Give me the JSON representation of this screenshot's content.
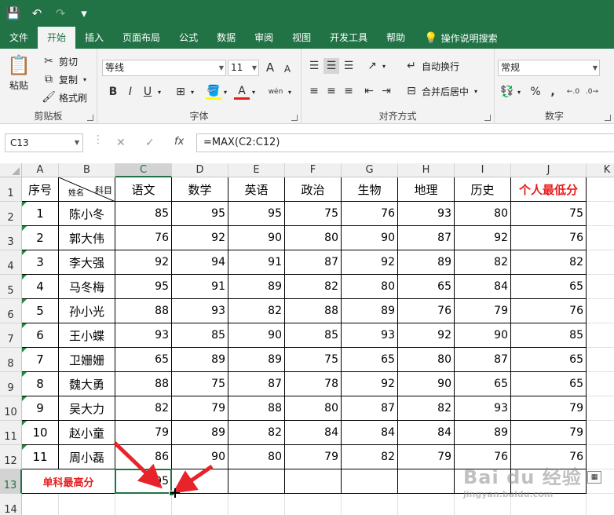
{
  "qat": {
    "save": "💾",
    "undo": "↶",
    "redo": "↷",
    "customize": "▾"
  },
  "tabs": [
    "文件",
    "开始",
    "插入",
    "页面布局",
    "公式",
    "数据",
    "审阅",
    "视图",
    "开发工具",
    "帮助"
  ],
  "active_tab": "开始",
  "tell_me": "操作说明搜索",
  "ribbon": {
    "clipboard": {
      "label": "剪贴板",
      "paste": "粘贴",
      "cut": "剪切",
      "copy": "复制",
      "format_painter": "格式刷"
    },
    "font": {
      "label": "字体",
      "font_name": "等线",
      "font_size": "11",
      "grow": "A",
      "shrink": "A",
      "bold": "B",
      "italic": "I",
      "underline": "U",
      "font_color": "A",
      "phonetic": "wén"
    },
    "alignment": {
      "label": "对齐方式",
      "wrap_text": "自动换行",
      "merge_center": "合并后居中"
    },
    "number": {
      "label": "数字",
      "format": "常规",
      "percent": "%",
      "comma": ","
    }
  },
  "formula_bar": {
    "name_box": "C13",
    "cancel": "✕",
    "enter": "✓",
    "fx": "fx",
    "formula": "=MAX(C2:C12)"
  },
  "columns": [
    "A",
    "B",
    "C",
    "D",
    "E",
    "F",
    "G",
    "H",
    "I",
    "J",
    "K"
  ],
  "rows": [
    "1",
    "2",
    "3",
    "4",
    "5",
    "6",
    "7",
    "8",
    "9",
    "10",
    "11",
    "12",
    "13",
    "14"
  ],
  "header_row": {
    "seq": "序号",
    "name_sub": "姓名",
    "subject_sub": "科目",
    "subjects": [
      "语文",
      "数学",
      "英语",
      "政治",
      "生物",
      "地理",
      "历史"
    ],
    "min_label": "个人最低分"
  },
  "data_rows": [
    {
      "seq": "1",
      "name": "陈小冬",
      "scores": [
        "85",
        "95",
        "95",
        "75",
        "76",
        "93",
        "80"
      ],
      "min": "75"
    },
    {
      "seq": "2",
      "name": "郭大伟",
      "scores": [
        "76",
        "92",
        "90",
        "80",
        "90",
        "87",
        "92"
      ],
      "min": "76"
    },
    {
      "seq": "3",
      "name": "李大强",
      "scores": [
        "92",
        "94",
        "91",
        "87",
        "92",
        "89",
        "82"
      ],
      "min": "82"
    },
    {
      "seq": "4",
      "name": "马冬梅",
      "scores": [
        "95",
        "91",
        "89",
        "82",
        "80",
        "65",
        "84"
      ],
      "min": "65"
    },
    {
      "seq": "5",
      "name": "孙小光",
      "scores": [
        "88",
        "93",
        "82",
        "88",
        "89",
        "76",
        "79"
      ],
      "min": "76"
    },
    {
      "seq": "6",
      "name": "王小蝶",
      "scores": [
        "93",
        "85",
        "90",
        "85",
        "93",
        "92",
        "90"
      ],
      "min": "85"
    },
    {
      "seq": "7",
      "name": "卫姗姗",
      "scores": [
        "65",
        "89",
        "89",
        "75",
        "65",
        "80",
        "87"
      ],
      "min": "65"
    },
    {
      "seq": "8",
      "name": "魏大勇",
      "scores": [
        "88",
        "75",
        "87",
        "78",
        "92",
        "90",
        "65"
      ],
      "min": "65"
    },
    {
      "seq": "9",
      "name": "吴大力",
      "scores": [
        "82",
        "79",
        "88",
        "80",
        "87",
        "82",
        "93"
      ],
      "min": "79"
    },
    {
      "seq": "10",
      "name": "赵小童",
      "scores": [
        "79",
        "89",
        "82",
        "84",
        "84",
        "84",
        "89"
      ],
      "min": "79"
    },
    {
      "seq": "11",
      "name": "周小磊",
      "scores": [
        "86",
        "90",
        "80",
        "79",
        "82",
        "79",
        "76"
      ],
      "min": "76"
    }
  ],
  "summary_row": {
    "label": "单科最高分",
    "c13": "95"
  },
  "watermark": {
    "text": "Bai du 经验",
    "sub": "jingyan.baidu.com"
  },
  "colors": {
    "accent": "#217346",
    "red": "#e81c1c",
    "arrow": "#e8242b"
  }
}
